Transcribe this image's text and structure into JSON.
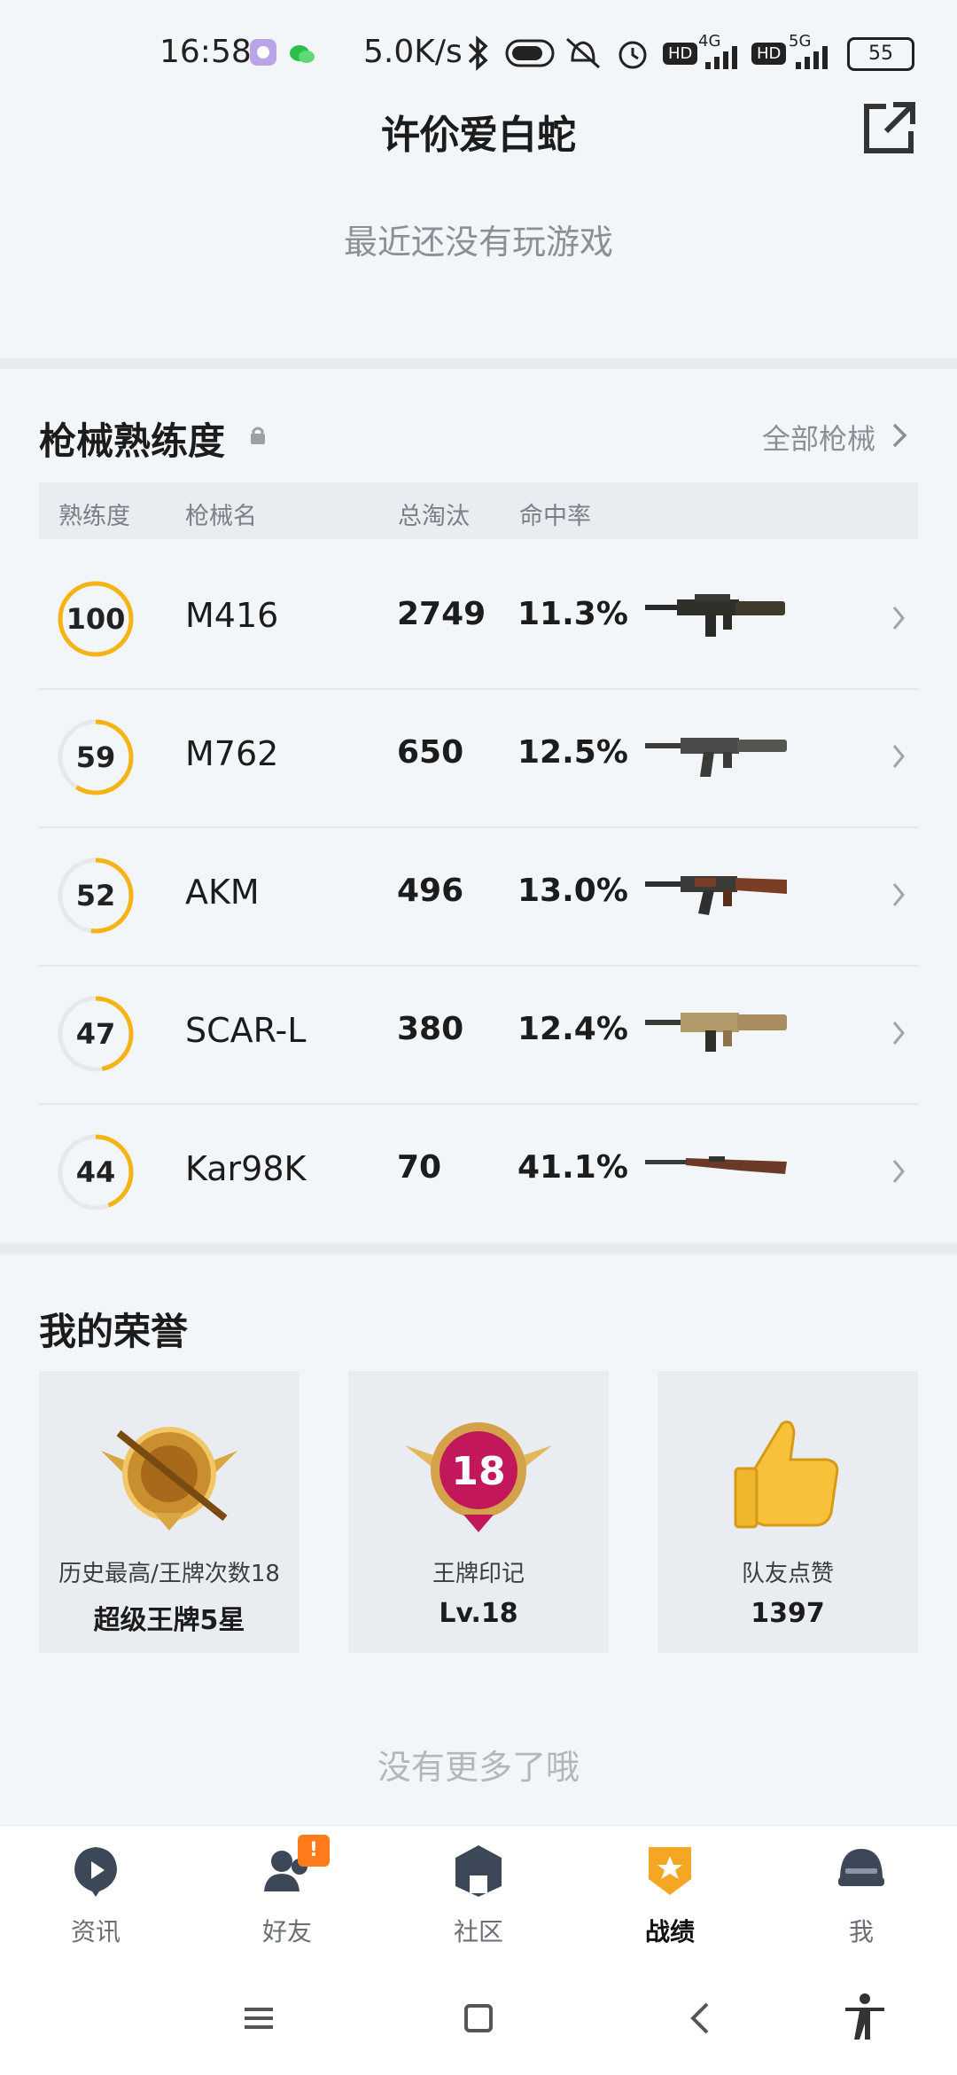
{
  "status_bar": {
    "time": "16:58",
    "net_speed": "5.0K/s",
    "network_4g": "4G",
    "network_5g": "5G",
    "hd_1": "HD",
    "hd_2": "HD",
    "battery": "55"
  },
  "header": {
    "title": "许伱爱白蛇",
    "share_icon": "external-link-icon"
  },
  "recent_games": {
    "empty_text": "最近还没有玩游戏"
  },
  "weapon_section": {
    "title": "枪械熟练度",
    "all_link": "全部枪械",
    "columns": {
      "proficiency": "熟练度",
      "name": "枪械名",
      "kills": "总淘汰",
      "accuracy": "命中率"
    },
    "rows": [
      {
        "proficiency": "100",
        "name": "M416",
        "kills": "2749",
        "accuracy": "11.3%",
        "progress": 1.0,
        "icon": "m416-rifle-icon"
      },
      {
        "proficiency": "59",
        "name": "M762",
        "kills": "650",
        "accuracy": "12.5%",
        "progress": 0.59,
        "icon": "m762-rifle-icon"
      },
      {
        "proficiency": "52",
        "name": "AKM",
        "kills": "496",
        "accuracy": "13.0%",
        "progress": 0.52,
        "icon": "akm-rifle-icon"
      },
      {
        "proficiency": "47",
        "name": "SCAR-L",
        "kills": "380",
        "accuracy": "12.4%",
        "progress": 0.47,
        "icon": "scar-l-rifle-icon"
      },
      {
        "proficiency": "44",
        "name": "Kar98K",
        "kills": "70",
        "accuracy": "41.1%",
        "progress": 0.44,
        "icon": "kar98k-rifle-icon"
      }
    ]
  },
  "honor_section": {
    "title": "我的荣誉",
    "cards": [
      {
        "label": "历史最高/王牌次数18",
        "value": "超级王牌5星",
        "icon": "ace-emblem-icon"
      },
      {
        "label": "王牌印记",
        "value": "Lv.18",
        "icon": "ace-mark-18-icon",
        "badge_number": "18"
      },
      {
        "label": "队友点赞",
        "value": "1397",
        "icon": "thumbs-up-icon"
      }
    ]
  },
  "footer": {
    "no_more": "没有更多了哦"
  },
  "bottom_nav": {
    "items": [
      {
        "label": "资讯",
        "icon": "news-play-icon"
      },
      {
        "label": "好友",
        "icon": "friends-icon",
        "badge": "!"
      },
      {
        "label": "社区",
        "icon": "community-icon"
      },
      {
        "label": "战绩",
        "icon": "record-shield-icon",
        "active": true
      },
      {
        "label": "我",
        "icon": "helmet-profile-icon"
      }
    ]
  },
  "colors": {
    "accent": "#f5b316",
    "ring_track": "#e6e8eb",
    "badge": "#ff7a1a"
  }
}
